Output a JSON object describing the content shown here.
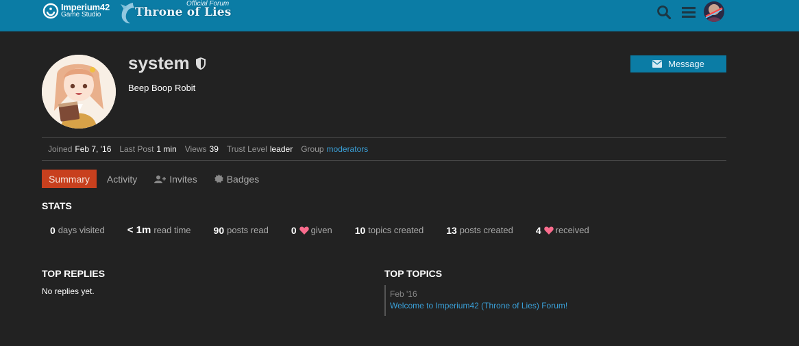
{
  "header": {
    "logo_primary": "Imperium42",
    "logo_secondary": "Game Studio",
    "forum_tag": "Official Forum",
    "forum_name": "Throne of Lies",
    "accent": "#0b7ca5"
  },
  "profile": {
    "username": "system",
    "bio": "Beep Boop Robit",
    "message_button": "Message"
  },
  "meta": {
    "joined_label": "Joined",
    "joined_value": "Feb 7, '16",
    "last_post_label": "Last Post",
    "last_post_value": "1 min",
    "views_label": "Views",
    "views_value": "39",
    "trust_label": "Trust Level",
    "trust_value": "leader",
    "group_label": "Group",
    "group_value": "moderators"
  },
  "tabs": [
    {
      "label": "Summary"
    },
    {
      "label": "Activity"
    },
    {
      "label": "Invites"
    },
    {
      "label": "Badges"
    }
  ],
  "stats": {
    "title": "STATS",
    "items": [
      {
        "num": "0",
        "desc": "days visited"
      },
      {
        "num": "< 1m",
        "desc": "read time"
      },
      {
        "num": "90",
        "desc": "posts read"
      },
      {
        "num": "0",
        "desc": "given"
      },
      {
        "num": "10",
        "desc": "topics created"
      },
      {
        "num": "13",
        "desc": "posts created"
      },
      {
        "num": "4",
        "desc": "received"
      }
    ]
  },
  "top_replies": {
    "title": "TOP REPLIES",
    "empty": "No replies yet."
  },
  "top_topics": {
    "title": "TOP TOPICS",
    "items": [
      {
        "date": "Feb '16",
        "title": "Welcome to Imperium42 (Throne of Lies) Forum!"
      }
    ]
  },
  "colors": {
    "active_tab": "#c8401e",
    "link": "#3aa0d8",
    "heart": "#fa6c8d"
  }
}
